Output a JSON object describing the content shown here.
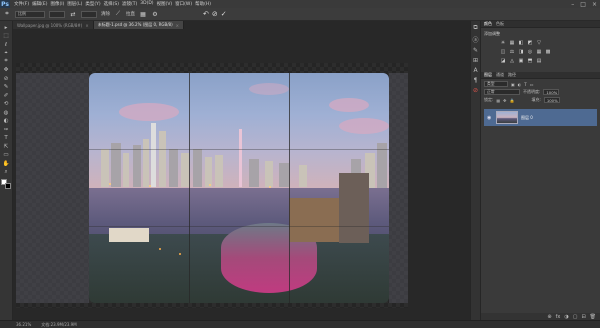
{
  "app": {
    "logo": "Ps"
  },
  "menu": [
    "文件(F)",
    "编辑(E)",
    "图像(I)",
    "图层(L)",
    "类型(Y)",
    "选择(S)",
    "滤镜(T)",
    "3D(D)",
    "视图(V)",
    "窗口(W)",
    "帮助(H)"
  ],
  "window_controls": [
    "–",
    "□",
    "×"
  ],
  "options_bar": {
    "ratio_value": "比例",
    "w": "",
    "h": "",
    "clear_label": "清除",
    "straighten_label": "拉直",
    "commit_icons": [
      "↶",
      "⊘",
      "✓"
    ]
  },
  "tabs": [
    {
      "label": "Wallpaper.jpg @ 100% (RGB/8#)",
      "active": false
    },
    {
      "label": "未标题-1.psd @ 36.2% (图层 0, RGB/8)",
      "active": true
    }
  ],
  "tools": [
    "▸",
    "⬚",
    "ℓ",
    "⌖",
    "⌗",
    "✥",
    "⊘",
    "✎",
    "✐",
    "⟲",
    "◍",
    "◐",
    "✑",
    "T",
    "⇱",
    "▭",
    "✋",
    "⌕"
  ],
  "status": {
    "zoom": "36.21%",
    "doc": "文档:23.9M/23.9M"
  },
  "right_strip_icons": [
    "⧉",
    "ⓐ",
    "✎",
    "⊞",
    "A",
    "¶",
    "⊘"
  ],
  "panels": {
    "top_tabs": [
      "颜色",
      "色板"
    ],
    "adjustments_title": "添加调整",
    "adjust_icons_row1": [
      "☀",
      "▦",
      "◧",
      "◩",
      "▽"
    ],
    "adjust_icons_row2": [
      "◫",
      "⚖",
      "◨",
      "◎",
      "▦",
      "▩"
    ],
    "adjust_icons_row3": [
      "◪",
      "◬",
      "▣",
      "⬒",
      "▤"
    ],
    "layer_tabs": [
      "图层",
      "通道",
      "路径"
    ],
    "kind_label": "类型",
    "blend_mode": "正常",
    "opacity_label": "不透明度:",
    "opacity_value": "100%",
    "lock_label": "锁定:",
    "fill_label": "填充:",
    "fill_value": "100%",
    "layers": [
      {
        "name": "图层 0",
        "visible": true
      }
    ],
    "footer_icons": [
      "⊕",
      "fx",
      "◑",
      "▢",
      "⊟",
      "🗑"
    ]
  }
}
